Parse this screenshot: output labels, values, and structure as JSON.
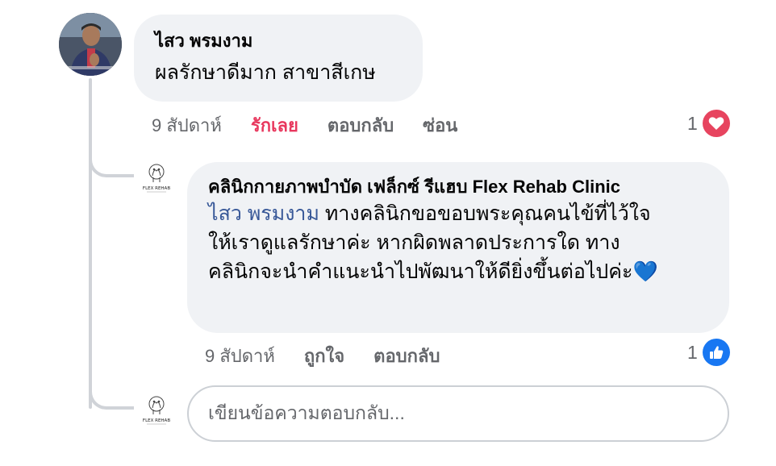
{
  "comment": {
    "author": "ไสว พรมงาม",
    "text": "ผลรักษาดีมาก สาขาสีเกษ",
    "time": "9 สัปดาห์",
    "like_label": "รักเลย",
    "reply_label": "ตอบกลับ",
    "hide_label": "ซ่อน",
    "reaction_count": "1",
    "reaction_icon": "love-heart-icon",
    "colors": {
      "liked": "#e8385e",
      "love_reaction": "#e7445f"
    }
  },
  "reply": {
    "author": "คลินิกกายภาพบำบัด เฟล็กซ์ รีแฮบ Flex Rehab Clinic",
    "avatar_label": "FLEX REHAB",
    "mention": "ไสว พรมงาม",
    "text_line1": " ทางคลินิกขอขอบพระคุณคนไข้ที่ไว้ใจ",
    "text_line2": "ให้เราดูแลรักษาค่ะ หากผิดพลาดประการใด ทาง",
    "text_line3": "คลินิกจะนำคำแนะนำไปพัฒนาให้ดียิ่งขึ้นต่อไปค่ะ",
    "emoji": "💙",
    "time": "9 สัปดาห์",
    "like_label": "ถูกใจ",
    "reply_label": "ตอบกลับ",
    "reaction_count": "1",
    "reaction_icon": "thumbs-up-icon",
    "colors": {
      "mention": "#385898",
      "like_reaction": "#1877f2"
    }
  },
  "reply_box": {
    "placeholder": "เขียนข้อความตอบกลับ...",
    "avatar_label": "FLEX REHAB"
  }
}
